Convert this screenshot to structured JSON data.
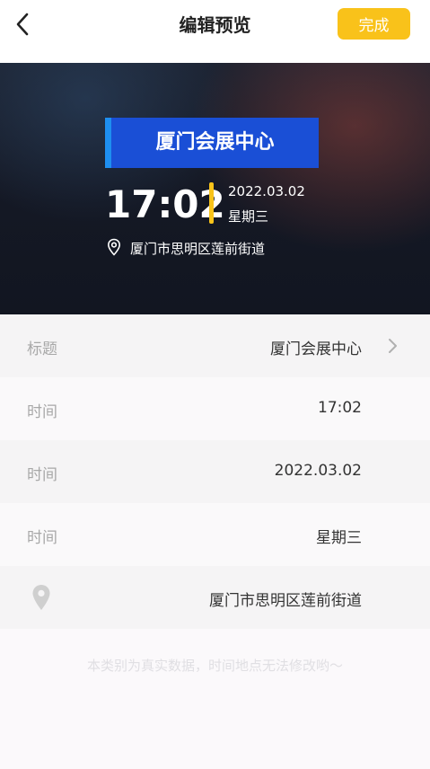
{
  "header": {
    "title": "编辑预览",
    "done_label": "完成"
  },
  "preview": {
    "location_title": "厦门会展中心",
    "time": "17:02",
    "date": "2022.03.02",
    "weekday": "星期三",
    "address": "厦门市思明区莲前街道"
  },
  "rows": [
    {
      "label": "标题",
      "value": "厦门会展中心"
    },
    {
      "label": "时间",
      "value": "17:02"
    },
    {
      "label": "时间",
      "value": "2022.03.02"
    },
    {
      "label": "时间",
      "value": "星期三"
    },
    {
      "value": "厦门市思明区莲前街道"
    }
  ],
  "footnote": "本类别为真实数据，时间地点无法修改哟～",
  "colors": {
    "accent_yellow": "#f9c21a",
    "title_box_blue": "#1a4fd6",
    "title_box_stripe": "#1e8ff0"
  },
  "icons": {
    "back": "chevron-left-icon",
    "row_arrow": "chevron-right-icon",
    "location": "location-pin-icon"
  }
}
